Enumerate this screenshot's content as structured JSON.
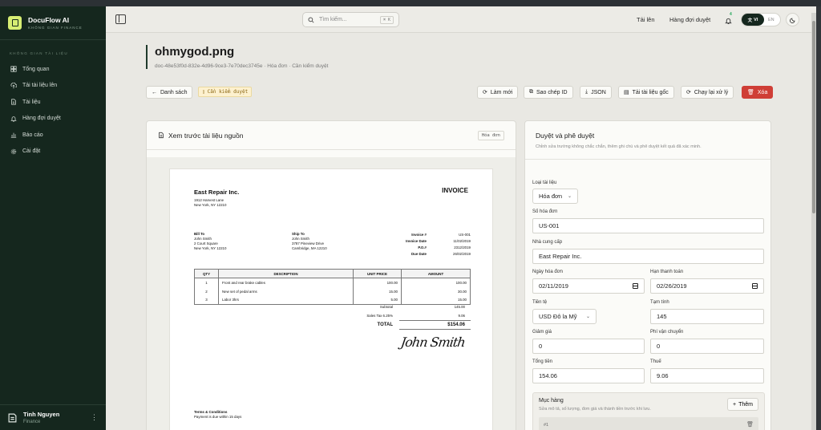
{
  "app": {
    "name": "DocuFlow AI",
    "tagline": "KHÔNG GIAN FINANCE"
  },
  "sidebar": {
    "section_label": "KHÔNG GIAN TÀI LIỆU",
    "items": [
      {
        "label": "Tổng quan",
        "icon": "dashboard-icon"
      },
      {
        "label": "Tải tài liệu lên",
        "icon": "upload-icon"
      },
      {
        "label": "Tài liệu",
        "icon": "document-icon"
      },
      {
        "label": "Hàng đợi duyệt",
        "icon": "bell-icon"
      },
      {
        "label": "Báo cáo",
        "icon": "chart-icon"
      },
      {
        "label": "Cài đặt",
        "icon": "gear-icon"
      }
    ],
    "user": {
      "name": "Tinh Nguyen",
      "role": "Finance"
    }
  },
  "topbar": {
    "search_placeholder": "Tìm kiếm...",
    "shortcut": "⌘ K",
    "upload_link": "Tải lên",
    "queue_link": "Hàng đợi duyệt",
    "notification_count": "4",
    "lang_active": "VI",
    "lang_other": "EN"
  },
  "document": {
    "title": "ohmygod.png",
    "meta": "doc-48e53f0d-832e-4d96-9ce3-7e70dec3745e · Hóa đơn · Cần kiểm duyệt"
  },
  "actions": {
    "back": "Danh sách",
    "status_badge": "Cần kiểm duyệt",
    "refresh": "Làm mới",
    "copy_id": "Sao chép ID",
    "json": "JSON",
    "download": "Tải tài liệu gốc",
    "reprocess": "Chạy lại xử lý",
    "delete": "Xóa"
  },
  "preview": {
    "title": "Xem trước tài liệu nguồn",
    "tag": "Hóa đơn",
    "invoice": {
      "company": "East Repair Inc.",
      "heading": "INVOICE",
      "address1": "1912 Harvest Lane",
      "address2": "New York, NY 12210",
      "bill_to_label": "Bill To",
      "bill_to": [
        "John Smith",
        "2 Court Square",
        "New York, NY 12210"
      ],
      "ship_to_label": "Ship To",
      "ship_to": [
        "John Smith",
        "3787 Pineview Drive",
        "Cambridge, MA 12210"
      ],
      "meta_labels": [
        "Invoice #",
        "Invoice Date",
        "P.O.#",
        "Due Date"
      ],
      "meta_values": [
        "US-001",
        "11/02/2019",
        "2312/2019",
        "26/02/2019"
      ],
      "columns": [
        "QTY",
        "DESCRIPTION",
        "UNIT PRICE",
        "AMOUNT"
      ],
      "rows": [
        [
          "1",
          "Front and rear brake cables",
          "100.00",
          "100.00"
        ],
        [
          "2",
          "New set of pedal arms",
          "15.00",
          "30.00"
        ],
        [
          "3",
          "Labor 3hrs",
          "5.00",
          "15.00"
        ]
      ],
      "subtotal_label": "Subtotal",
      "subtotal": "145.00",
      "tax_label": "Sales Tax 6.25%",
      "tax": "9.06",
      "total_label": "TOTAL",
      "total": "$154.06",
      "signature": "John Smith",
      "terms_title": "Terms & Conditions",
      "terms_text": "Payment is due within 15 days"
    }
  },
  "form": {
    "title": "Duyệt và phê duyệt",
    "subtitle": "Chỉnh sửa trường không chắc chắn, thêm ghi chú và phê duyệt kết quả đã xác minh.",
    "doc_type_label": "Loại tài liệu",
    "doc_type": "Hóa đơn",
    "invoice_no_label": "Số hóa đơn",
    "invoice_no": "US-001",
    "vendor_label": "Nhà cung cấp",
    "vendor": "East Repair Inc.",
    "invoice_date_label": "Ngày hóa đơn",
    "invoice_date": "02/11/2019",
    "due_date_label": "Hạn thanh toán",
    "due_date": "02/26/2019",
    "currency_label": "Tiền tệ",
    "currency": "USD  Đô la Mỹ",
    "subtotal_label": "Tạm tính",
    "subtotal": "145",
    "discount_label": "Giảm giá",
    "discount": "0",
    "shipping_label": "Phí vận chuyển",
    "shipping": "0",
    "total_label": "Tổng tiền",
    "total": "154.06",
    "tax_label": "Thuế",
    "tax": "9.06",
    "items_title": "Mục hàng",
    "items_sub": "Sửa mô tả, số lượng, đơn giá và thành tiền trước khi lưu.",
    "add_label": "Thêm",
    "first_item": "#1"
  }
}
